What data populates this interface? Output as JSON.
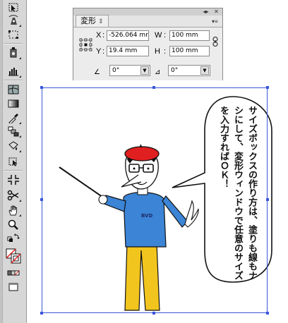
{
  "transform_panel": {
    "tab_label": "変形",
    "x_label": "X",
    "x_value": "-526.064 mr",
    "y_label": "Y",
    "y_value": "19.4 mm",
    "w_label": "W",
    "w_value": "100 mm",
    "h_label": "H",
    "h_value": "100 mm",
    "rotate_value": "0°",
    "shear_value": "0°"
  },
  "artwork": {
    "bubble_text": "サイズボックスの作り方は、塗りも線もナシにして、変形ウィンドウで任意のサイズを入力すればＯＫ！",
    "shirt_logo": "BVD"
  },
  "colors": {
    "selection": "#3a56d8",
    "shirt": "#3b84d6",
    "pants": "#f2c51e",
    "beret": "#e02020"
  },
  "tools": [
    "selection-tool-icon",
    "direct-selection-tool-icon",
    "pen-tool-icon",
    "lasso-tool-icon",
    "artboard-tool-icon",
    "slice-tool-icon",
    "graph-tool-icon",
    "mesh-tool-icon",
    "gradient-tool-icon",
    "eyedropper-tool-icon",
    "blend-tool-icon",
    "live-paint-tool-icon",
    "live-paint-selection-icon",
    "crop-marks-icon",
    "scissors-tool-icon",
    "hand-tool-icon",
    "zoom-tool-icon",
    "fill-stroke-icon",
    "screen-mode-icon"
  ]
}
